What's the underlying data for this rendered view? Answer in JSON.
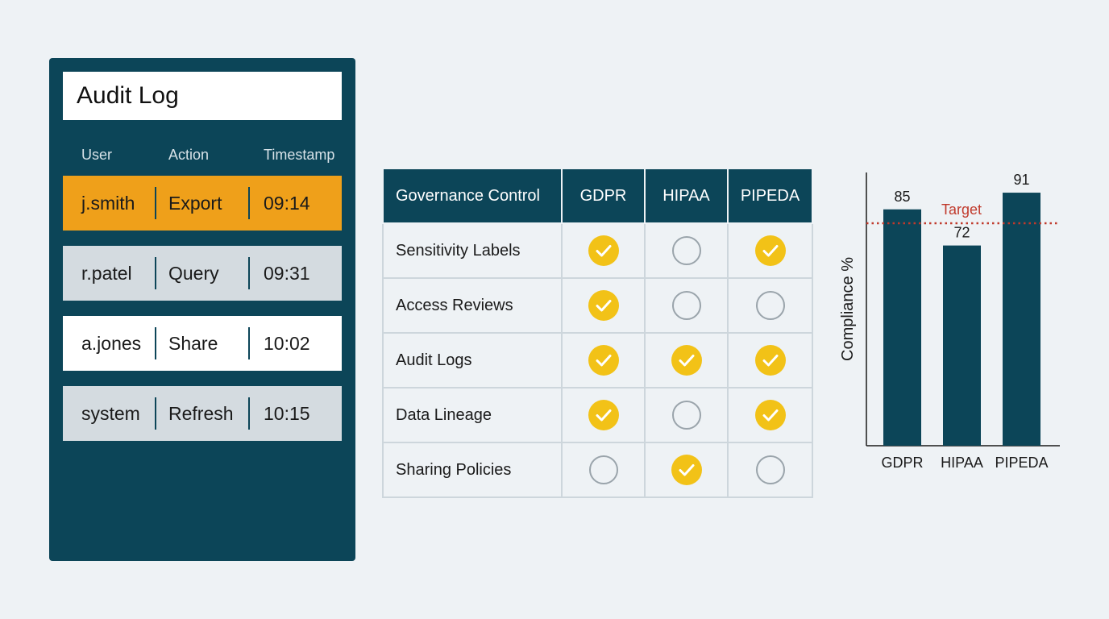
{
  "audit_log": {
    "title": "Audit Log",
    "columns": [
      "User",
      "Action",
      "Timestamp"
    ],
    "rows": [
      {
        "user": "j.smith",
        "action": "Export",
        "time": "09:14",
        "highlighted": true
      },
      {
        "user": "r.patel",
        "action": "Query",
        "time": "09:31",
        "highlighted": false
      },
      {
        "user": "a.jones",
        "action": "Share",
        "time": "10:02",
        "highlighted": false
      },
      {
        "user": "system",
        "action": "Refresh",
        "time": "10:15",
        "highlighted": false
      }
    ],
    "highlight_color": "#efa01a"
  },
  "governance_table": {
    "headers": [
      "Governance Control",
      "GDPR",
      "HIPAA",
      "PIPEDA"
    ],
    "rows": [
      {
        "control": "Sensitivity Labels",
        "values": [
          true,
          false,
          true
        ]
      },
      {
        "control": "Access Reviews",
        "values": [
          true,
          false,
          false
        ]
      },
      {
        "control": "Audit Logs",
        "values": [
          true,
          true,
          true
        ]
      },
      {
        "control": "Data Lineage",
        "values": [
          true,
          false,
          true
        ]
      },
      {
        "control": "Sharing Policies",
        "values": [
          false,
          true,
          false
        ]
      }
    ],
    "check_color": "#f2c217",
    "header_color": "#0c4558"
  },
  "chart_data": {
    "type": "bar",
    "categories": [
      "GDPR",
      "HIPAA",
      "PIPEDA"
    ],
    "values": [
      85,
      72,
      91
    ],
    "ylabel": "Compliance %",
    "target_label": "Target",
    "target_value": 80,
    "bar_color": "#0c4558",
    "target_color": "#c0392b",
    "ylim": [
      0,
      100
    ]
  }
}
